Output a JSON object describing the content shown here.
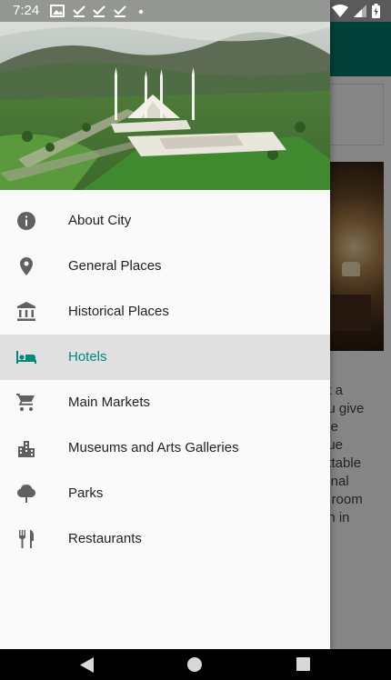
{
  "status_bar": {
    "time": "7:24",
    "icons": [
      "image-icon",
      "check-icon",
      "check-icon",
      "check-icon",
      "dot-icon",
      "wifi-icon",
      "signal-icon",
      "battery-icon"
    ]
  },
  "drawer": {
    "header_image": "faisal-mosque-aerial",
    "items": [
      {
        "label": "About City",
        "icon": "info-icon",
        "active": false
      },
      {
        "label": "General Places",
        "icon": "location-pin-icon",
        "active": false
      },
      {
        "label": "Historical Places",
        "icon": "museum-icon",
        "active": false
      },
      {
        "label": "Hotels",
        "icon": "hotel-bed-icon",
        "active": true
      },
      {
        "label": "Main Markets",
        "icon": "shopping-cart-icon",
        "active": false
      },
      {
        "label": "Museums and Arts Galleries",
        "icon": "city-buildings-icon",
        "active": false
      },
      {
        "label": "Parks",
        "icon": "tree-icon",
        "active": false
      },
      {
        "label": "Restaurants",
        "icon": "restaurant-icon",
        "active": false
      }
    ]
  },
  "background_page": {
    "text_lines": [
      "et a",
      "ou give",
      "ble",
      "que",
      "ettable",
      "ional",
      "d room",
      "an in"
    ]
  },
  "colors": {
    "accent": "#00897b",
    "toolbar": "#00796b",
    "active_item_bg": "#e0e0e0",
    "icon_default": "#616161"
  }
}
